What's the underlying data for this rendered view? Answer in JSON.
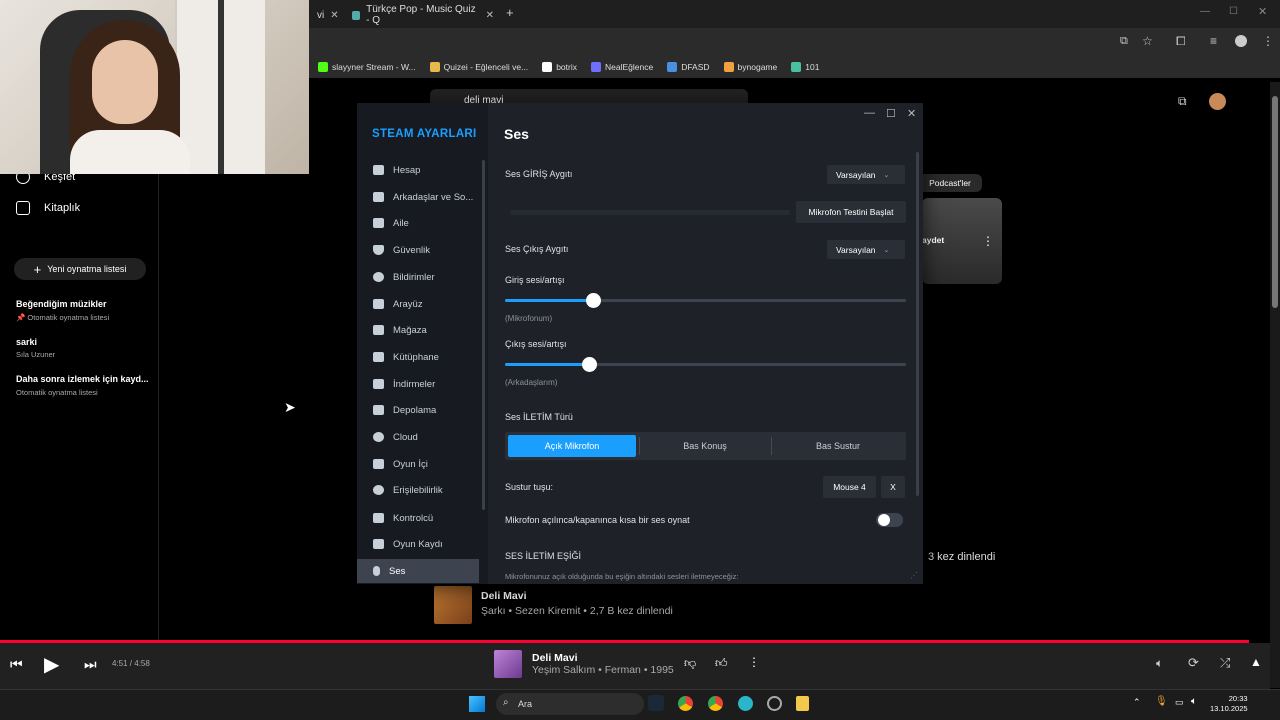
{
  "browser": {
    "tabs": [
      {
        "label": "vi"
      },
      {
        "label": "Türkçe Pop - Music Quiz - Q"
      }
    ],
    "bookmarks": [
      {
        "label": "slayyner Stream - W...",
        "color": "#53fc18"
      },
      {
        "label": "Quizei - Eğlenceli ve...",
        "color": "#e9b84a"
      },
      {
        "label": "botrix",
        "color": "#ffffff"
      },
      {
        "label": "NealEğlence",
        "color": "#6f6fff"
      },
      {
        "label": "DFASD",
        "color": "#4a90e2"
      },
      {
        "label": "bynogame",
        "color": "#f2a23c"
      },
      {
        "label": "101",
        "color": "#4ac0a0"
      }
    ]
  },
  "yt": {
    "nav": [
      {
        "label": "Keşfet",
        "icon": "compass-icon"
      },
      {
        "label": "Kitaplık",
        "icon": "library-icon"
      }
    ],
    "new_playlist": "Yeni oynatma listesi",
    "playlists": [
      {
        "title": "Beğendiğim müzikler",
        "sub": "📌 Otomatik oynatma listesi"
      },
      {
        "title": "sarki",
        "sub": "Sıla Uzuner"
      },
      {
        "title": "Daha sonra izlemek için kayd...",
        "sub": "Otomatik oynatma listesi"
      }
    ],
    "search_value": "deli mavi",
    "chip": "Podcast'ler",
    "card_button": "aydet",
    "bg_plays": "3 kez dinlendi",
    "song": {
      "title": "Deli Mavi",
      "sub": "Şarkı • Sezen Kiremit • 2,7 B kez dinlendi"
    }
  },
  "player": {
    "time": "4:51 / 4:58",
    "title": "Deli Mavi",
    "sub": "Yeşim Salkım • Ferman • 1995",
    "progress": 0.976
  },
  "taskbar": {
    "search": "Ara",
    "time": "20:33",
    "date": "13.10.2025"
  },
  "steam": {
    "header": "STEAM AYARLARI",
    "nav": [
      {
        "label": "Hesap",
        "icon": "account-icon"
      },
      {
        "label": "Arkadaşlar ve So...",
        "icon": "friends-icon"
      },
      {
        "label": "Aile",
        "icon": "family-icon"
      },
      {
        "label": "Güvenlik",
        "icon": "shield-icon"
      },
      {
        "label": "Bildirimler",
        "icon": "notification-icon"
      },
      {
        "label": "Arayüz",
        "icon": "monitor-icon"
      },
      {
        "label": "Mağaza",
        "icon": "cart-icon"
      },
      {
        "label": "Kütüphane",
        "icon": "grid-icon"
      },
      {
        "label": "İndirmeler",
        "icon": "download-icon"
      },
      {
        "label": "Depolama",
        "icon": "storage-icon"
      },
      {
        "label": "Cloud",
        "icon": "cloud-icon"
      },
      {
        "label": "Oyun İçi",
        "icon": "ingame-icon"
      },
      {
        "label": "Erişilebilirlik",
        "icon": "accessibility-icon"
      },
      {
        "label": "Kontrolcü",
        "icon": "controller-icon"
      },
      {
        "label": "Oyun Kaydı",
        "icon": "recording-icon"
      },
      {
        "label": "Ses",
        "icon": "microphone-icon",
        "active": true
      }
    ],
    "title": "Ses",
    "input_device_label": "Ses GİRİŞ Aygıtı",
    "input_device_value": "Varsayılan",
    "mic_test": "Mikrofon Testini Başlat",
    "output_device_label": "Ses Çıkış Aygıtı",
    "output_device_value": "Varsayılan",
    "input_gain_label": "Giriş sesi/artışı",
    "input_gain_sub": "(Mikrofonum)",
    "input_gain_value": 0.22,
    "output_gain_label": "Çıkış sesi/artışı",
    "output_gain_sub": "(Arkadaşlarım)",
    "output_gain_value": 0.21,
    "transmission_label": "Ses İLETİM Türü",
    "transmission_options": [
      "Açık Mikrofon",
      "Bas Konuş",
      "Bas Sustur"
    ],
    "mute_key_label": "Sustur tuşu:",
    "mute_key_value": "Mouse 4",
    "mute_key_clear": "X",
    "beep_label": "Mikrofon açılınca/kapanınca kısa bir ses oynat",
    "beep_on": false,
    "threshold_label": "SES İLETİM EŞİĞİ",
    "threshold_desc": "Mikrofonunuz açık olduğunda bu eşiğin altındaki sesleri iletmeyeceğiz:"
  },
  "colors": {
    "accent": "#1a9fff",
    "progress": "#ff0033"
  }
}
